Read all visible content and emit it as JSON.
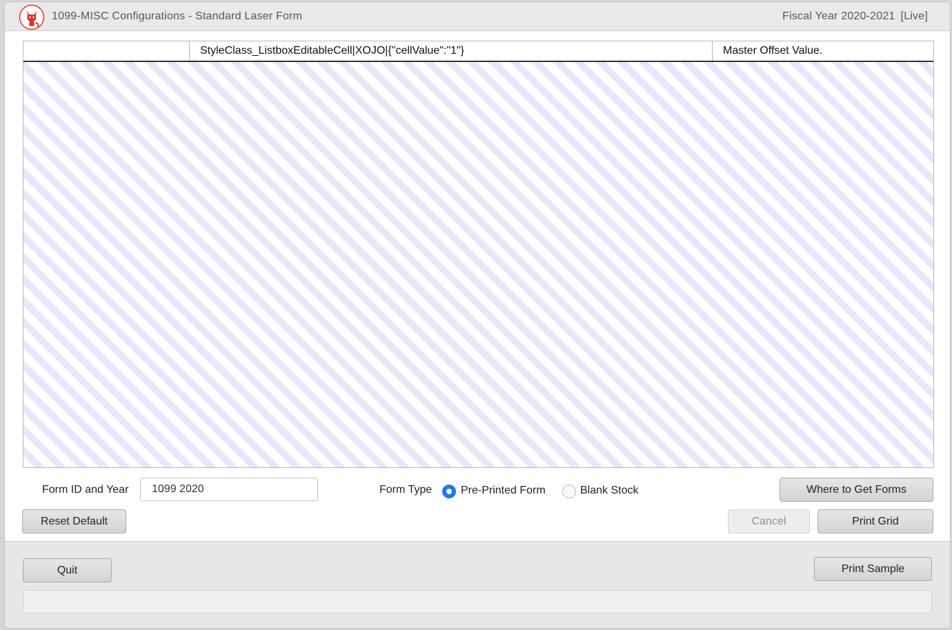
{
  "titlebar": {
    "title": "1099-MISC Configurations - Standard Laser Form",
    "fiscal_year": "Fiscal Year 2020-2021",
    "mode": "[Live]",
    "logo_icon": "fox-logo-icon"
  },
  "grid": {
    "columns": [
      "",
      "StyleClass_ListboxEditableCell|XOJO|{\"cellValue\":\"1\"}",
      "Master Offset Value."
    ]
  },
  "form": {
    "form_id_label": "Form ID and Year",
    "form_id_value": "1099 2020",
    "form_type_label": "Form Type",
    "pre_printed_label": "Pre-Printed Form",
    "blank_stock_label": "Blank Stock",
    "selected_form_type": "Pre-Printed Form"
  },
  "buttons": {
    "where_to_get": "Where to Get Forms",
    "reset_default": "Reset Default",
    "cancel": "Cancel",
    "print_grid": "Print Grid",
    "quit": "Quit",
    "print_sample": "Print Sample"
  },
  "colors": {
    "accent": "#1a7bf2",
    "stripe": "#e7e7fb",
    "logo_red": "#d9362b"
  }
}
